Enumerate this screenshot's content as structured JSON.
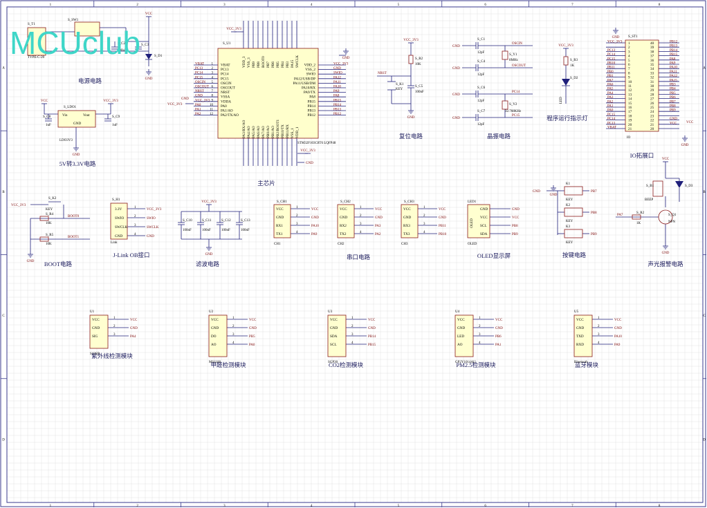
{
  "logo": "MCUclub",
  "colors": {
    "grid": "#d9d9d9",
    "border": "#3a3a8c",
    "wire": "#1f1f7a",
    "body_fill": "#ffffd0",
    "logo": "#3fd6c8",
    "accent": "#7a0000"
  },
  "border": {
    "cols": [
      "1",
      "2",
      "3",
      "4",
      "5",
      "6",
      "7",
      "8"
    ],
    "rows": [
      "A",
      "B",
      "C",
      "D"
    ]
  },
  "captions": {
    "power": "电源电路",
    "ldo": "5V转3.3V电路",
    "mcu": "主芯片",
    "reset": "复位电路",
    "crystal": "晶振电路",
    "led": "程序运行指示灯",
    "io": "IO拓展口",
    "boot": "BOOT电路",
    "jlink": "J-Link OB接口",
    "filter": "滤波电路",
    "uart": "串口电路",
    "oled": "OLED显示屏",
    "keys": "按键电路",
    "alarm": "声光报警电路",
    "uv": "紫外线检测模块",
    "hcho": "甲醛检测模块",
    "co2": "CO2检测模块",
    "pm25": "PM2.5检测模块",
    "bt": "蓝牙模块"
  },
  "mcu": {
    "ref": "S_U1",
    "part": "STM32F103C8T6 LQFP48",
    "left_pins": [
      "VBAT",
      "PC13",
      "PC14",
      "PC15",
      "OSCIN",
      "OSCOUT",
      "NRST",
      "VSSA",
      "VDDA",
      "PA0",
      "PA1/AO",
      "PA2/TX/AO"
    ],
    "right_pins": [
      "VDD_2",
      "VSS_2",
      "SWIO",
      "PA12/USB/DP",
      "PA11/USB/DM",
      "PA10/RX",
      "PA9/TX",
      "PA8",
      "PB15",
      "PB14",
      "PB13",
      "PB12"
    ],
    "top_pins": [
      "VDD_3",
      "VSS_3",
      "PB9",
      "PB8",
      "BOOT0",
      "PB7",
      "PB6",
      "PB5",
      "PB4",
      "PB3",
      "PA15",
      "SWCLK"
    ],
    "bottom_pins": [
      "PA3/RX/AO",
      "PA4/AO",
      "PA5/AO",
      "PA6/AO",
      "PA7/AO",
      "PB0/AO",
      "PB1/AO",
      "PB2/BOOT1",
      "PB10/TX",
      "PB11/RX",
      "VSS_1",
      "VDD_1"
    ],
    "right_nets": [
      "VCC_3V3",
      "GND",
      "SWIO",
      "PA12",
      "PA11",
      "PA10",
      "PA9",
      "PA8",
      "PB15",
      "PB14",
      "PB13",
      "PB12"
    ],
    "left_nets": [
      "VBAT",
      "PC13",
      "PC14",
      "PC15",
      "OSCIN",
      "OSCOUT",
      "NRST",
      "GND",
      "VCC_3V3",
      "PA0",
      "PA1",
      "PA2"
    ]
  },
  "nets": {
    "vcc": "VCC",
    "vcc33": "VCC_3V3",
    "gnd": "GND",
    "nrst": "NRST",
    "boot0": "BOOT0",
    "boot1": "BOOT1",
    "oscin": "OSCIN",
    "oscout": "OSCOUT",
    "pc14": "PC14",
    "pc15": "PC15"
  },
  "power": {
    "jack": "TYPE-C-20",
    "switch": "S_SW1",
    "jack_ref": "S_T1",
    "c2": "S_C2",
    "c3": "S_C3",
    "c2v": "100uF",
    "d1": "S_D1"
  },
  "ldo": {
    "ref": "S_LDO1",
    "part": "LDO3V3",
    "vin": "Vin",
    "vout": "Vout",
    "gnd": "GND",
    "c8": "S_C8",
    "c9": "S_C9",
    "c8v": "1uF",
    "c9v": "1uF"
  },
  "reset": {
    "r": "S_R2",
    "rv": "10K",
    "k": "S_K1",
    "kv": "KEY",
    "c": "S_C5",
    "cv": "100nF"
  },
  "crystal": {
    "c1": "S_C1",
    "c4": "S_C4",
    "c6": "S_C6",
    "c7": "S_C7",
    "cv": "12pF",
    "y1": "S_Y1",
    "y1v": "8MHz",
    "y2": "S_Y2",
    "y2v": "32.768KHz"
  },
  "runled": {
    "r": "S_R3",
    "rv": "1K",
    "d": "S_D2",
    "dv": "LED"
  },
  "io": {
    "ref": "S_ST1",
    "left_nets": [
      "VCC_3V3",
      "",
      "PC13",
      "PC14",
      "PC15",
      "PB10",
      "PB11",
      "PB0",
      "PB1",
      "PA7",
      "PA6",
      "PA5",
      "PA4",
      "PA3",
      "PA2",
      "PA1",
      "PA0",
      "PC15",
      "PC14",
      "PC13",
      "VBAT"
    ],
    "right_nets": [
      "PB12",
      "PB13",
      "PB14",
      "PB15",
      "PA8",
      "PA9",
      "PA10",
      "PA11",
      "PA12",
      "PA15",
      "PB3",
      "PB4",
      "PB5",
      "PB6",
      "PB7",
      "PB8",
      "PB9",
      "",
      "GND",
      "VCC",
      ""
    ],
    "left_nums": [
      "1",
      "2",
      "3",
      "4",
      "5",
      "6",
      "7",
      "8",
      "9",
      "10",
      "11",
      "12",
      "13",
      "14",
      "15",
      "16",
      "17",
      "18",
      "19",
      "20",
      "21"
    ],
    "right_nums": [
      "40",
      "39",
      "38",
      "37",
      "36",
      "35",
      "34",
      "33",
      "32",
      "31",
      "30",
      "29",
      "28",
      "27",
      "26",
      "25",
      "24",
      "23",
      "22",
      "21",
      "20"
    ],
    "bottom": "IO"
  },
  "boot": {
    "k": "S_K2",
    "kv": "KEY",
    "r4": "S_R4",
    "r5": "S_R5",
    "rv": "10K"
  },
  "jlink": {
    "ref": "S_H1",
    "pins": [
      "3.3V",
      "SWIO",
      "SWCLK",
      "GND"
    ],
    "nets": [
      "VCC_3V3",
      "SWIO",
      "SWCLK",
      "GND"
    ],
    "bottom": "Link"
  },
  "filter": {
    "caps": [
      "S_C10",
      "S_C11",
      "S_C12",
      "S_C13"
    ],
    "cv": "100nF"
  },
  "uart": [
    {
      "ref": "S_CH1",
      "bottom": "CH1",
      "pins": [
        "VCC",
        "GND",
        "RX1",
        "TX1"
      ],
      "nets": [
        "VCC",
        "GND",
        "PA10",
        "PA9"
      ]
    },
    {
      "ref": "S_CH2",
      "bottom": "CH2",
      "pins": [
        "VCC",
        "GND",
        "RX2",
        "TX2"
      ],
      "nets": [
        "VCC",
        "GND",
        "PA3",
        "PA2"
      ]
    },
    {
      "ref": "S_CH3",
      "bottom": "CH3",
      "pins": [
        "VCC",
        "GND",
        "RX3",
        "TX3"
      ],
      "nets": [
        "VCC",
        "GND",
        "PB11",
        "PB10"
      ]
    }
  ],
  "oled": {
    "ref": "LED1",
    "bottom": "OLED",
    "inner": "OLED",
    "pins": [
      "GND",
      "VCC",
      "SCL",
      "SDA"
    ],
    "nets": [
      "GND",
      "VCC",
      "PB8",
      "PB9"
    ]
  },
  "keys": [
    {
      "ref": "K1",
      "v": "KEY",
      "net": "PB7"
    },
    {
      "ref": "K2",
      "v": "KEY",
      "net": "PB8"
    },
    {
      "ref": "K3",
      "v": "KEY",
      "net": "PB9"
    }
  ],
  "alarm": {
    "buzzer": "S_B1",
    "bz": "BEEP",
    "d": "S_D3",
    "r": "S_R2",
    "rv": "1K",
    "q": "S_Q1",
    "qv": "NPN",
    "net": "PA7"
  },
  "modules": [
    {
      "ref": "U1",
      "part": "S12SD",
      "pins": [
        "VCC",
        "GND",
        "SIG"
      ],
      "nets": [
        "VCC",
        "GND",
        "PA4"
      ]
    },
    {
      "ref": "U2",
      "part": "MS1100",
      "pins": [
        "VCC",
        "GND",
        "DO",
        "AO"
      ],
      "nets": [
        "VCC",
        "GND",
        "PB5",
        "PA0"
      ]
    },
    {
      "ref": "U3",
      "part": "SGP30",
      "pins": [
        "VCC",
        "GND",
        "SDA",
        "SCL"
      ],
      "nets": [
        "VCC",
        "GND",
        "PB14",
        "PB15"
      ]
    },
    {
      "ref": "U4",
      "part": "GP2Y1014AU",
      "pins": [
        "VCC",
        "GND",
        "LED",
        "AO"
      ],
      "nets": [
        "VCC",
        "GND",
        "PB6",
        "PA1"
      ]
    },
    {
      "ref": "U5",
      "part": "Bluetooth",
      "pins": [
        "VCC",
        "GND",
        "TXD",
        "RXD"
      ],
      "nets": [
        "VCC",
        "GND",
        "PA10",
        "PA9"
      ]
    }
  ]
}
